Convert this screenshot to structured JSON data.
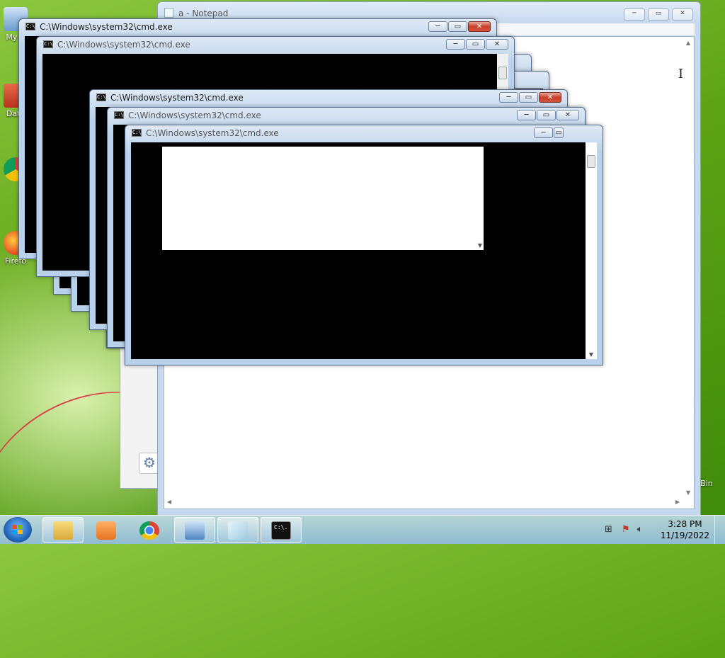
{
  "desktop": {
    "icons": [
      {
        "label": "My C",
        "name": "computer"
      },
      {
        "label": "Data",
        "name": "database"
      },
      {
        "label": "",
        "name": "chrome"
      },
      {
        "label": "Firefo",
        "name": "firefox"
      }
    ],
    "recycle_bin_label": "Bin"
  },
  "notepad": {
    "title": "a - Notepad",
    "minimize_glyph": "─",
    "maximize_glyph": "▭",
    "close_glyph": "✕"
  },
  "cmd_windows": [
    {
      "title": "C:\\Windows\\system32\\cmd.exe",
      "state": "active"
    },
    {
      "title": "C:\\Windows\\system32\\cmd.exe",
      "state": "inactive"
    },
    {
      "title": "C:\\Windows\\system32\\cmd.exe",
      "state": "active"
    },
    {
      "title": "C:\\Windows\\system32\\cmd.exe",
      "state": "inactive"
    },
    {
      "title": "C:\\Windows\\system32\\cmd.exe",
      "state": "inactive"
    }
  ],
  "cmd_icon_text": "C:\\.",
  "taskbar": {
    "items": [
      {
        "name": "explorer",
        "icon": "folder-icon"
      },
      {
        "name": "media-player",
        "icon": "media-player-icon"
      },
      {
        "name": "chrome",
        "icon": "chrome-icon"
      },
      {
        "name": "control-panel",
        "icon": "control-panel-icon"
      },
      {
        "name": "notepad",
        "icon": "notepad-icon"
      },
      {
        "name": "cmd",
        "icon": "cmd-icon"
      }
    ],
    "clock_time": "3:28 PM",
    "clock_date": "11/19/2022"
  },
  "colors": {
    "accent": "#3d8a0a",
    "close_button": "#c7402a",
    "titlebar": "#b9d1ea"
  }
}
